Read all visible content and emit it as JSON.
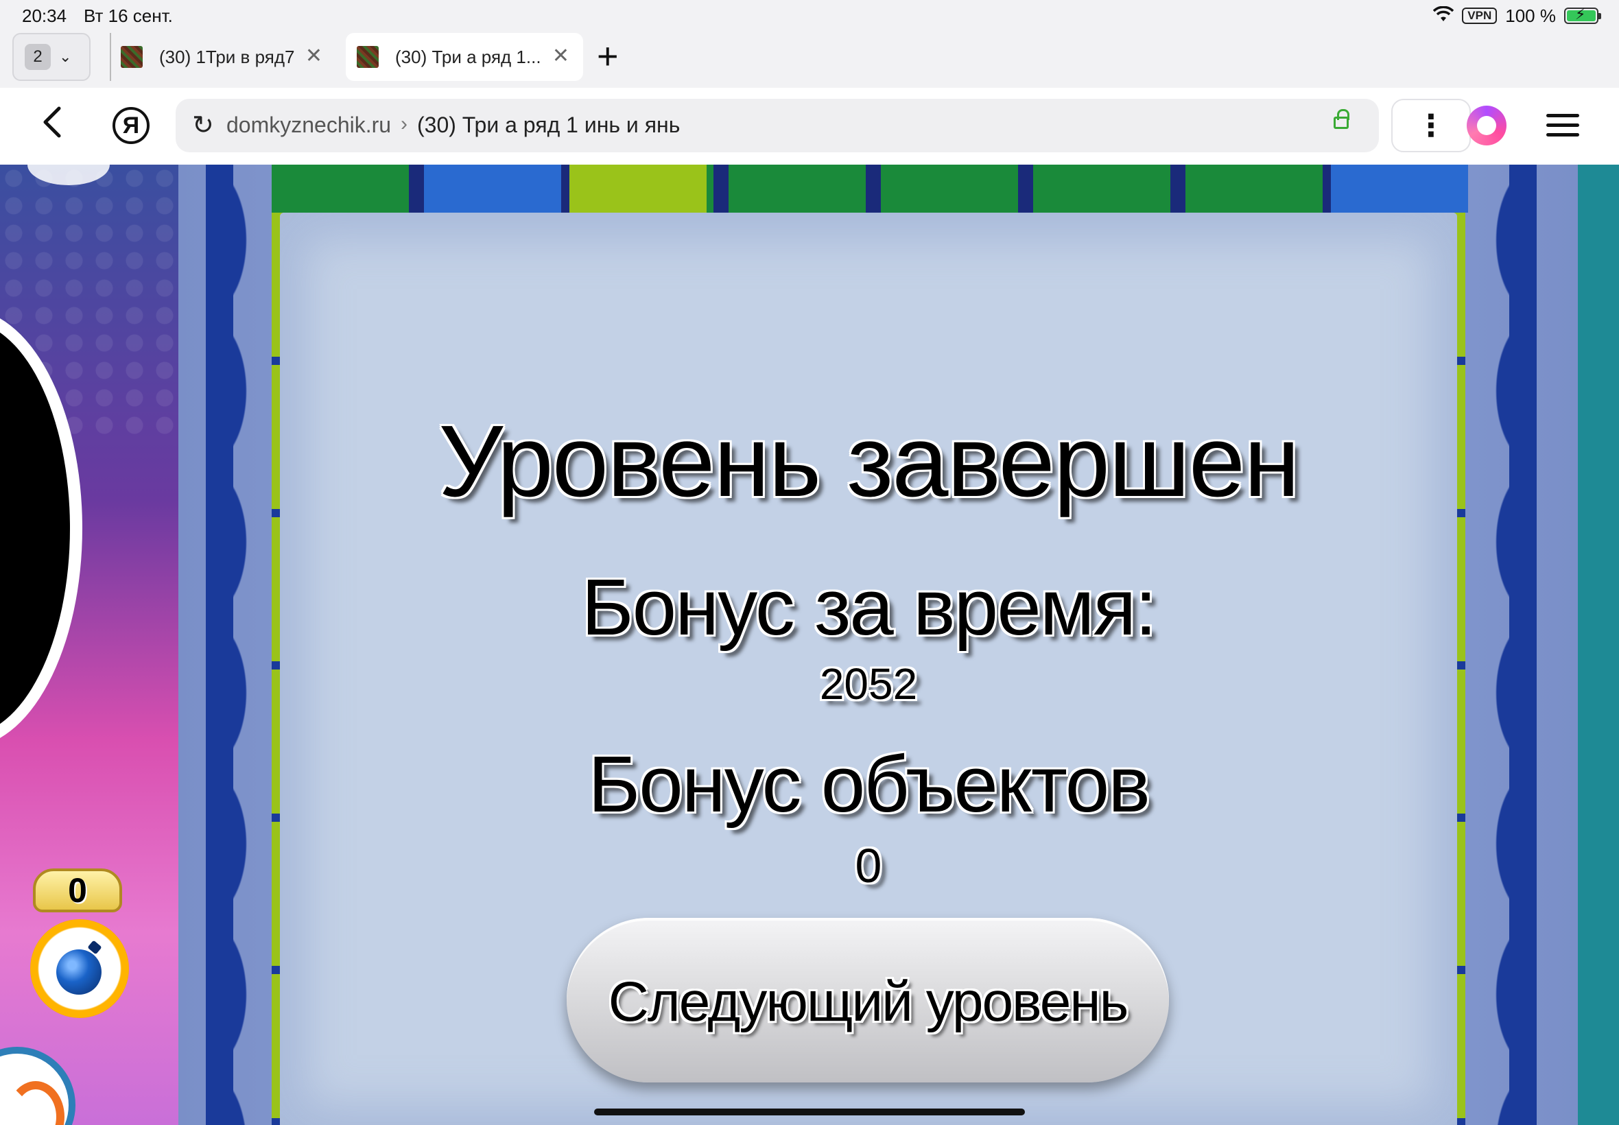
{
  "status_bar": {
    "time": "20:34",
    "date": "Вт 16 сент.",
    "vpn": "VPN",
    "battery": "100 %"
  },
  "tabs": {
    "count": "2",
    "items": [
      {
        "title": "(30) 1Три в ряд7",
        "active": false
      },
      {
        "title": "(30) Три а ряд 1...",
        "active": true
      }
    ]
  },
  "address_bar": {
    "domain": "domkyznechik.ru",
    "separator": "›",
    "page_title": "(30) Три а ряд 1 инь и янь"
  },
  "icons": {
    "back": "chevron-left-icon",
    "yandex": "Я",
    "reload": "reload-icon",
    "lock": "lock-icon",
    "more": "more-vertical-icon",
    "alice": "alice-icon",
    "menu": "hamburger-icon"
  },
  "game": {
    "dialog": {
      "title": "Уровень завершен",
      "time_bonus_label": "Бонус за время:",
      "time_bonus_value": "2052",
      "objects_bonus_label": "Бонус объектов",
      "objects_bonus_value": "0",
      "next_button": "Следующий уровень"
    },
    "bomb_count": "0"
  },
  "colors": {
    "dialog_bg": "#c3d1e6",
    "frame_blue": "#1a3a9a",
    "tile_green": "#1a8a3a",
    "tile_lime": "#9ac31a",
    "panel_pink": "#d94fb0"
  }
}
